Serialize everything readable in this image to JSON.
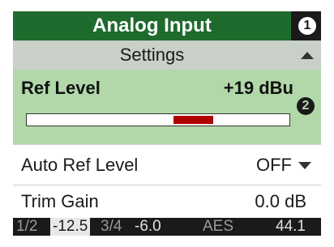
{
  "header": {
    "title": "Analog Input",
    "badge": "1"
  },
  "subheader": {
    "title": "Settings"
  },
  "ref_level": {
    "label": "Ref Level",
    "value": "+19 dBu",
    "badge": "2",
    "meter_fill_start": 0.56,
    "meter_fill_end": 0.71,
    "meter_color": "#b00000"
  },
  "auto_ref_level": {
    "label": "Auto Ref Level",
    "value": "OFF"
  },
  "trim_gain": {
    "label": "Trim Gain",
    "value": "0.0 dB"
  },
  "status": {
    "ch12_label": "1/2",
    "ch12_value": "-12.5",
    "ch34_label": "3/4",
    "ch34_value": "-6.0",
    "format": "AES",
    "sample_rate": "44.1"
  },
  "colors": {
    "header_green": "#1f6b2e",
    "selected_row": "#b2d8a9",
    "subheader": "#c8d0c8",
    "background": "#1a1a1a"
  }
}
